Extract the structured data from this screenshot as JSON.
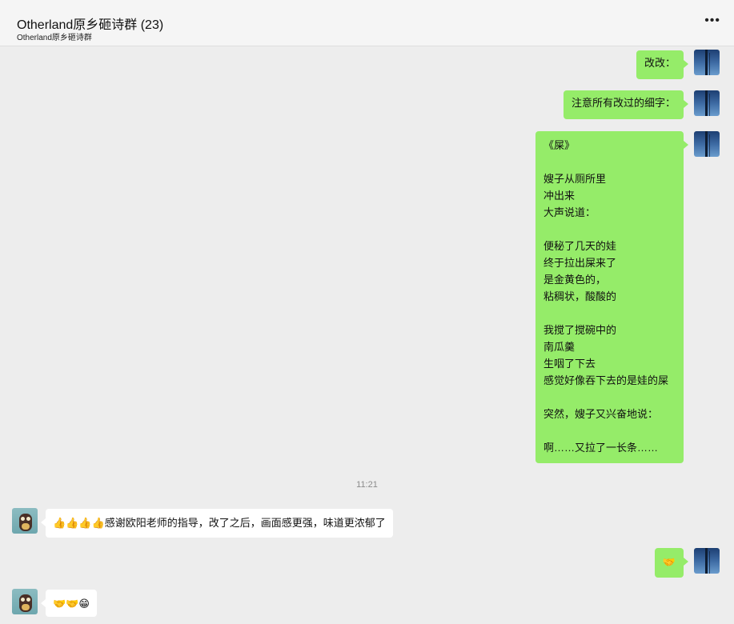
{
  "header": {
    "title": "Otherland原乡砸诗群 (23)",
    "subtitle": "Otherland原乡砸诗群",
    "more_icon": "•••"
  },
  "messages": {
    "m1": "改改：",
    "m2": "注意所有改过的细字：",
    "poem": [
      "《屎》",
      "",
      "嫂子从厕所里",
      "冲出来",
      "大声说道：",
      "",
      "便秘了几天的娃",
      "终于拉出屎来了",
      "是金黄色的，",
      "粘稠状，酸酸的",
      "",
      "我搅了搅碗中的",
      "南瓜羹",
      "生咽了下去",
      "感觉好像吞下去的是娃的屎",
      "",
      "突然，嫂子又兴奋地说：",
      "",
      "啊……又拉了一长条……"
    ],
    "timestamp": "11:21",
    "m4": "👍👍👍👍感谢欧阳老师的指导，改了之后，画面感更强，味道更浓郁了",
    "m5": "🤝",
    "m6": "🤝🤝😁"
  },
  "colors": {
    "bubble_me": "#95ec69",
    "bubble_other": "#ffffff",
    "background": "#ededed"
  }
}
